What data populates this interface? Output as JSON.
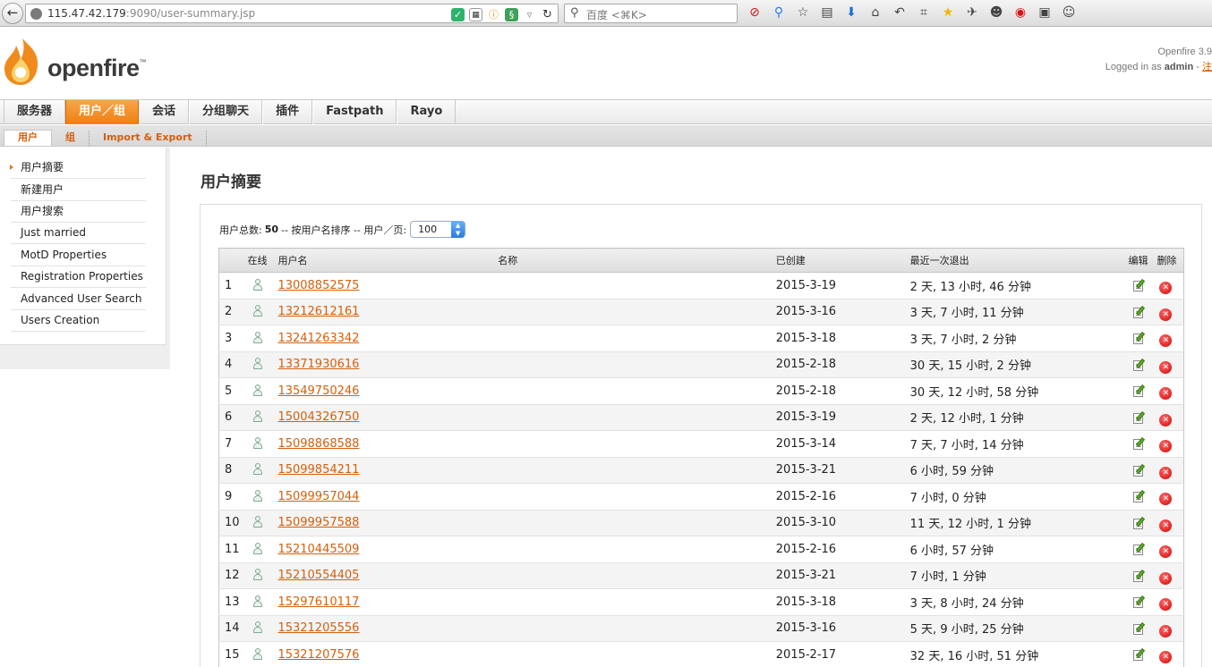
{
  "browser": {
    "url_host": "115.47.42.179",
    "url_rest": ":9090/user-summary.jsp",
    "search_placeholder": "百度 <⌘K>"
  },
  "header": {
    "logo_text": "openfire",
    "logo_tm": "™",
    "version": "Openfire 3.9",
    "logged_prefix": "Logged in as",
    "logged_user": "admin",
    "logged_sep": "-",
    "logout_label": "注"
  },
  "main_tabs": [
    "服务器",
    "用户／组",
    "会话",
    "分组聊天",
    "插件",
    "Fastpath",
    "Rayo"
  ],
  "sub_tabs": [
    "用户",
    "组",
    "Import & Export"
  ],
  "sidebar": {
    "items": [
      "用户摘要",
      "新建用户",
      "用户搜索",
      "Just married",
      "MotD Properties",
      "Registration Properties",
      "Advanced User Search",
      "Users Creation"
    ]
  },
  "page": {
    "title": "用户摘要",
    "summary_prefix": "用户总数:",
    "total": "50",
    "summary_suffix": "-- 按用户名排序 -- 用户／页:",
    "per_page": "100"
  },
  "table": {
    "headers": {
      "online": "在线",
      "username": "用户名",
      "name": "名称",
      "created": "已创建",
      "last_logout": "最近一次退出",
      "edit": "编辑",
      "delete": "删除"
    },
    "rows": [
      {
        "idx": "1",
        "username": "13008852575",
        "name": "",
        "created": "2015-3-19",
        "last": "2 天, 13 小时, 46 分钟"
      },
      {
        "idx": "2",
        "username": "13212612161",
        "name": "",
        "created": "2015-3-16",
        "last": "3 天, 7 小时, 11 分钟"
      },
      {
        "idx": "3",
        "username": "13241263342",
        "name": "",
        "created": "2015-3-18",
        "last": "3 天, 7 小时, 2 分钟"
      },
      {
        "idx": "4",
        "username": "13371930616",
        "name": "",
        "created": "2015-2-18",
        "last": "30 天, 15 小时, 2 分钟"
      },
      {
        "idx": "5",
        "username": "13549750246",
        "name": "",
        "created": "2015-2-18",
        "last": "30 天, 12 小时, 58 分钟"
      },
      {
        "idx": "6",
        "username": "15004326750",
        "name": "",
        "created": "2015-3-19",
        "last": "2 天, 12 小时, 1 分钟"
      },
      {
        "idx": "7",
        "username": "15098868588",
        "name": "",
        "created": "2015-3-14",
        "last": "7 天, 7 小时, 14 分钟"
      },
      {
        "idx": "8",
        "username": "15099854211",
        "name": "",
        "created": "2015-3-21",
        "last": "6 小时, 59 分钟"
      },
      {
        "idx": "9",
        "username": "15099957044",
        "name": "",
        "created": "2015-2-16",
        "last": "7 小时, 0 分钟"
      },
      {
        "idx": "10",
        "username": "15099957588",
        "name": "",
        "created": "2015-3-10",
        "last": "11 天, 12 小时, 1 分钟"
      },
      {
        "idx": "11",
        "username": "15210445509",
        "name": "",
        "created": "2015-2-16",
        "last": "6 小时, 57 分钟"
      },
      {
        "idx": "12",
        "username": "15210554405",
        "name": "",
        "created": "2015-3-21",
        "last": "7 小时, 1 分钟"
      },
      {
        "idx": "13",
        "username": "15297610117",
        "name": "",
        "created": "2015-3-18",
        "last": "3 天, 8 小时, 24 分钟"
      },
      {
        "idx": "14",
        "username": "15321205556",
        "name": "",
        "created": "2015-3-16",
        "last": "5 天, 9 小时, 25 分钟"
      },
      {
        "idx": "15",
        "username": "15321207576",
        "name": "",
        "created": "2015-2-17",
        "last": "32 天, 16 小时, 51 分钟"
      }
    ]
  },
  "colors": {
    "accent": "#ef7f10",
    "link": "#d65f0a"
  }
}
